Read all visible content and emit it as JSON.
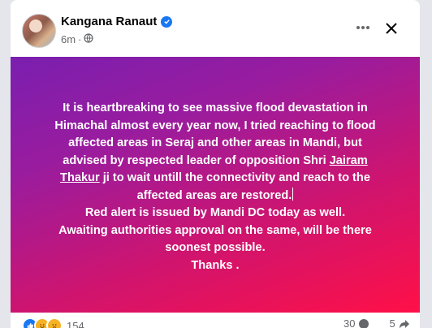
{
  "author": {
    "name": "Kangana Ranaut"
  },
  "post_meta": {
    "time": "6m",
    "separator": "·",
    "audience_icon": "globe-icon"
  },
  "post": {
    "lines": [
      "It is heartbreaking to see massive flood devastation in",
      "Himachal almost every year now, I tried reaching to flood",
      "affected areas in Seraj and other areas in Mandi, but",
      "advised by respected leader of opposition Shri"
    ],
    "mention_part1": "Jairam",
    "mention_part2": "Thakur",
    "after_mention": " ji to wait untill the connectivity and reach to the",
    "line_restored": "affected areas are restored.",
    "line_red_alert": "Red alert is issued by Mandi DC today as well.",
    "line_awaiting": "Awaiting authorities approval on the same, will be there",
    "line_soonest": "soonest possible.",
    "line_thanks": "Thanks ."
  },
  "footer": {
    "reaction_count": "154",
    "comment_count": "30",
    "share_count": "5"
  },
  "colors": {
    "gradient_start": "#7a1fb0",
    "gradient_end": "#ff1047",
    "verified": "#1877f2"
  }
}
